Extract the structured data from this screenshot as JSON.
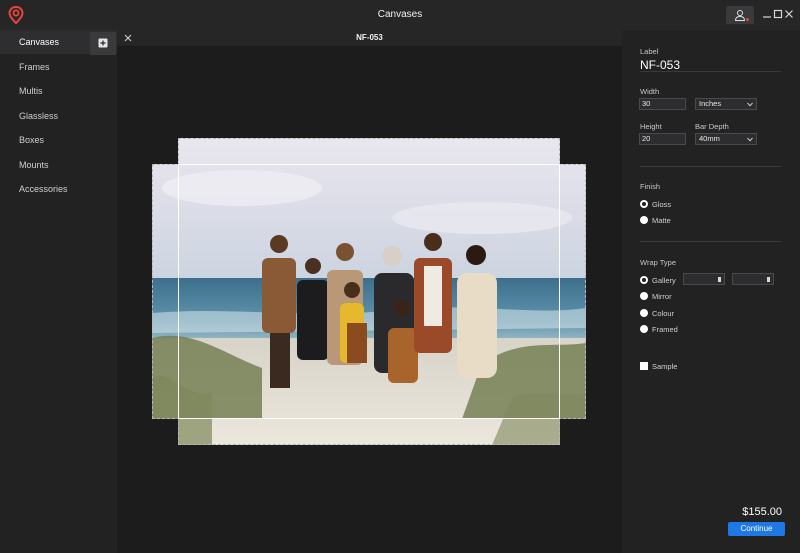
{
  "app": {
    "title": "Canvases",
    "accent_color": "#e8463a",
    "icons": [
      "location-pin-logo-icon",
      "user-icon",
      "minimize-icon",
      "maximize-icon",
      "close-icon"
    ]
  },
  "sidebar": {
    "items": [
      {
        "label": "Canvases",
        "active": true
      },
      {
        "label": "Frames"
      },
      {
        "label": "Multis"
      },
      {
        "label": "Glassless"
      },
      {
        "label": "Boxes"
      },
      {
        "label": "Mounts"
      },
      {
        "label": "Accessories"
      }
    ],
    "add_icon": "plus-square-icon"
  },
  "document": {
    "tab_title": "NF-053",
    "photo_description_icon": "family-photo"
  },
  "panel": {
    "label_heading": "Label",
    "label_value": "NF-053",
    "width_heading": "Width",
    "width_value": "30",
    "unit_value": "Inches",
    "height_heading": "Height",
    "height_value": "20",
    "bar_depth_heading": "Bar Depth",
    "bar_depth_value": "40mm",
    "finish_heading": "Finish",
    "finish_options": [
      {
        "label": "Gloss",
        "selected": true
      },
      {
        "label": "Matte",
        "selected": false
      }
    ],
    "wrap_heading": "Wrap Type",
    "wrap_options": [
      {
        "label": "Gallery",
        "selected": true
      },
      {
        "label": "Mirror",
        "selected": false
      },
      {
        "label": "Colour",
        "selected": false
      },
      {
        "label": "Framed",
        "selected": false
      }
    ],
    "sample_label": "Sample",
    "price": "$155.00",
    "continue_label": "Continue",
    "continue_color": "#1e78e6"
  }
}
